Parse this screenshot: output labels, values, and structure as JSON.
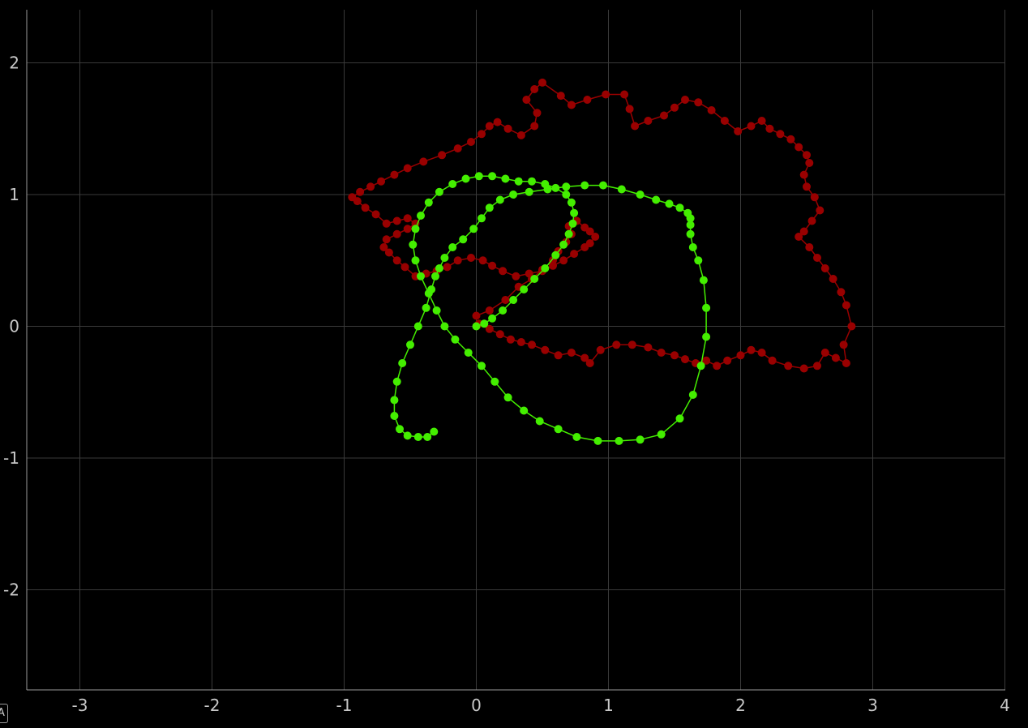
{
  "chart_data": {
    "type": "scatter",
    "title": "",
    "xlabel": "",
    "ylabel": "",
    "xlim": [
      -3.4,
      3.9
    ],
    "ylim": [
      -2.75,
      2.4
    ],
    "x_ticks": [
      -3,
      -2,
      -1,
      0,
      1,
      2,
      3,
      4
    ],
    "y_ticks": [
      2,
      1,
      0,
      -1,
      -2
    ],
    "grid": true,
    "legend": "none",
    "series": [
      {
        "color": "#990000",
        "mode": "lines+markers",
        "x": [
          0.0,
          0.1,
          0.22,
          0.32,
          0.42,
          0.5,
          0.58,
          0.62,
          0.68,
          0.72,
          0.7,
          0.76,
          0.82,
          0.86,
          0.9,
          0.86,
          0.82,
          0.74,
          0.66,
          0.58,
          0.5,
          0.4,
          0.3,
          0.2,
          0.12,
          0.05,
          -0.04,
          -0.14,
          -0.22,
          -0.3,
          -0.38,
          -0.46,
          -0.54,
          -0.6,
          -0.66,
          -0.7,
          -0.68,
          -0.6,
          -0.52,
          -0.46,
          -0.52,
          -0.6,
          -0.68,
          -0.76,
          -0.84,
          -0.9,
          -0.94,
          -0.88,
          -0.8,
          -0.72,
          -0.62,
          -0.52,
          -0.4,
          -0.26,
          -0.14,
          -0.04,
          0.04,
          0.1,
          0.16,
          0.24,
          0.34,
          0.44,
          0.46,
          0.38,
          0.44,
          0.5,
          0.64,
          0.72,
          0.84,
          0.98,
          1.12,
          1.16,
          1.2,
          1.3,
          1.42,
          1.5,
          1.58,
          1.68,
          1.78,
          1.88,
          1.98,
          2.08,
          2.16,
          2.22,
          2.3,
          2.38,
          2.44,
          2.5,
          2.52,
          2.48,
          2.5,
          2.56,
          2.6,
          2.54,
          2.48,
          2.44,
          2.52,
          2.58,
          2.64,
          2.7,
          2.76,
          2.8,
          2.84,
          2.78,
          2.8,
          2.72,
          2.64,
          2.58,
          2.48,
          2.36,
          2.24,
          2.16,
          2.08,
          2.0,
          1.9,
          1.82,
          1.74,
          1.66,
          1.58,
          1.5,
          1.4,
          1.3,
          1.18,
          1.06,
          0.94,
          0.86,
          0.82,
          0.72,
          0.62,
          0.52,
          0.42,
          0.34,
          0.26,
          0.18,
          0.1,
          0.02
        ],
        "y": [
          0.08,
          0.12,
          0.2,
          0.3,
          0.36,
          0.43,
          0.5,
          0.57,
          0.64,
          0.7,
          0.76,
          0.8,
          0.75,
          0.72,
          0.68,
          0.63,
          0.6,
          0.55,
          0.5,
          0.46,
          0.42,
          0.4,
          0.38,
          0.42,
          0.46,
          0.5,
          0.52,
          0.5,
          0.45,
          0.42,
          0.4,
          0.38,
          0.45,
          0.5,
          0.56,
          0.6,
          0.66,
          0.7,
          0.74,
          0.78,
          0.82,
          0.8,
          0.78,
          0.85,
          0.9,
          0.95,
          0.98,
          1.02,
          1.06,
          1.1,
          1.15,
          1.2,
          1.25,
          1.3,
          1.35,
          1.4,
          1.46,
          1.52,
          1.55,
          1.5,
          1.45,
          1.52,
          1.62,
          1.72,
          1.8,
          1.85,
          1.75,
          1.68,
          1.72,
          1.76,
          1.76,
          1.65,
          1.52,
          1.56,
          1.6,
          1.66,
          1.72,
          1.7,
          1.64,
          1.56,
          1.48,
          1.52,
          1.56,
          1.5,
          1.46,
          1.42,
          1.36,
          1.3,
          1.24,
          1.15,
          1.06,
          0.98,
          0.88,
          0.8,
          0.72,
          0.68,
          0.6,
          0.52,
          0.44,
          0.36,
          0.26,
          0.16,
          0.0,
          -0.14,
          -0.28,
          -0.24,
          -0.2,
          -0.3,
          -0.32,
          -0.3,
          -0.26,
          -0.2,
          -0.18,
          -0.22,
          -0.26,
          -0.3,
          -0.26,
          -0.28,
          -0.25,
          -0.22,
          -0.2,
          -0.16,
          -0.14,
          -0.14,
          -0.18,
          -0.28,
          -0.24,
          -0.2,
          -0.22,
          -0.18,
          -0.14,
          -0.12,
          -0.1,
          -0.06,
          -0.02,
          0.02
        ]
      },
      {
        "color": "#44ee00",
        "mode": "lines+markers",
        "x": [
          0.0,
          0.06,
          0.12,
          0.2,
          0.28,
          0.36,
          0.44,
          0.52,
          0.6,
          0.66,
          0.7,
          0.73,
          0.74,
          0.72,
          0.68,
          0.6,
          0.52,
          0.42,
          0.32,
          0.22,
          0.12,
          0.02,
          -0.08,
          -0.18,
          -0.28,
          -0.36,
          -0.42,
          -0.46,
          -0.48,
          -0.46,
          -0.42,
          -0.36,
          -0.3,
          -0.24,
          -0.16,
          -0.06,
          0.04,
          0.14,
          0.24,
          0.36,
          0.48,
          0.62,
          0.76,
          0.92,
          1.08,
          1.24,
          1.4,
          1.54,
          1.64,
          1.7,
          1.74,
          1.74,
          1.72,
          1.68,
          1.64,
          1.62,
          1.62,
          1.62,
          1.6,
          1.54,
          1.46,
          1.36,
          1.24,
          1.1,
          0.96,
          0.82,
          0.68,
          0.54,
          0.4,
          0.28,
          0.18,
          0.1,
          0.04,
          -0.02,
          -0.1,
          -0.18,
          -0.24,
          -0.28,
          -0.31,
          -0.34,
          -0.38,
          -0.44,
          -0.5,
          -0.56,
          -0.6,
          -0.62,
          -0.62,
          -0.58,
          -0.52,
          -0.44,
          -0.37,
          -0.32
        ],
        "y": [
          0.0,
          0.02,
          0.06,
          0.12,
          0.2,
          0.28,
          0.36,
          0.44,
          0.54,
          0.62,
          0.7,
          0.78,
          0.86,
          0.94,
          1.0,
          1.05,
          1.08,
          1.1,
          1.1,
          1.12,
          1.14,
          1.14,
          1.12,
          1.08,
          1.02,
          0.94,
          0.84,
          0.74,
          0.62,
          0.5,
          0.38,
          0.25,
          0.12,
          0.0,
          -0.1,
          -0.2,
          -0.3,
          -0.42,
          -0.54,
          -0.64,
          -0.72,
          -0.78,
          -0.84,
          -0.87,
          -0.87,
          -0.86,
          -0.82,
          -0.7,
          -0.52,
          -0.3,
          -0.08,
          0.14,
          0.35,
          0.5,
          0.6,
          0.7,
          0.77,
          0.82,
          0.86,
          0.9,
          0.93,
          0.96,
          1.0,
          1.04,
          1.07,
          1.07,
          1.06,
          1.04,
          1.02,
          1.0,
          0.96,
          0.9,
          0.82,
          0.74,
          0.66,
          0.6,
          0.52,
          0.44,
          0.38,
          0.28,
          0.14,
          0.0,
          -0.14,
          -0.28,
          -0.42,
          -0.56,
          -0.68,
          -0.78,
          -0.83,
          -0.84,
          -0.84,
          -0.8
        ]
      }
    ]
  }
}
